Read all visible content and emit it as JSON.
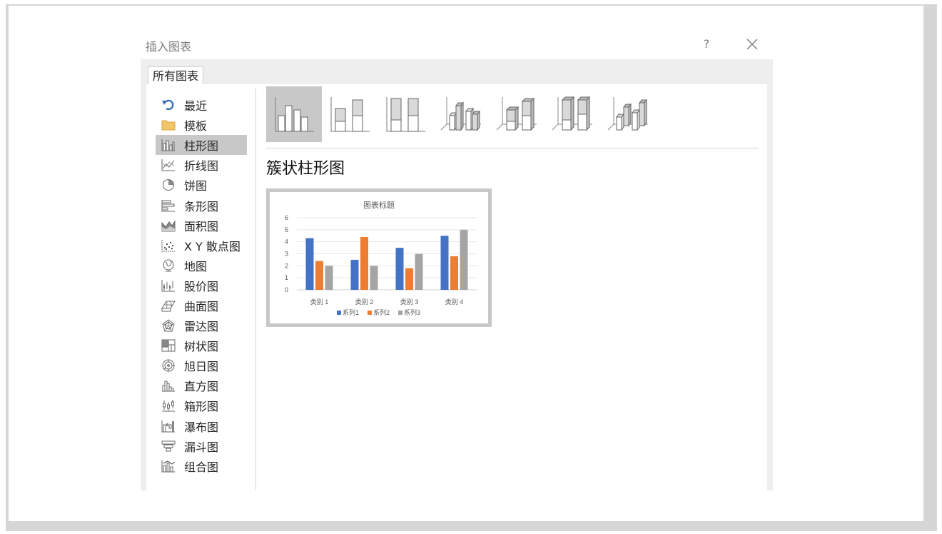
{
  "dialog": {
    "title": "插入图表",
    "help_label": "?",
    "close_icon": "close-icon"
  },
  "tabs": [
    {
      "label": "所有图表",
      "selected": true
    }
  ],
  "sidebar": {
    "items": [
      {
        "label": "最近",
        "icon": "recent-icon",
        "selected": false
      },
      {
        "label": "模板",
        "icon": "folder-icon",
        "selected": false
      },
      {
        "label": "柱形图",
        "icon": "column-chart-icon",
        "selected": true
      },
      {
        "label": "折线图",
        "icon": "line-chart-icon",
        "selected": false
      },
      {
        "label": "饼图",
        "icon": "pie-chart-icon",
        "selected": false
      },
      {
        "label": "条形图",
        "icon": "bar-chart-icon",
        "selected": false
      },
      {
        "label": "面积图",
        "icon": "area-chart-icon",
        "selected": false
      },
      {
        "label": "X Y 散点图",
        "icon": "scatter-chart-icon",
        "selected": false
      },
      {
        "label": "地图",
        "icon": "map-chart-icon",
        "selected": false
      },
      {
        "label": "股价图",
        "icon": "stock-chart-icon",
        "selected": false
      },
      {
        "label": "曲面图",
        "icon": "surface-chart-icon",
        "selected": false
      },
      {
        "label": "雷达图",
        "icon": "radar-chart-icon",
        "selected": false
      },
      {
        "label": "树状图",
        "icon": "treemap-chart-icon",
        "selected": false
      },
      {
        "label": "旭日图",
        "icon": "sunburst-chart-icon",
        "selected": false
      },
      {
        "label": "直方图",
        "icon": "histogram-chart-icon",
        "selected": false
      },
      {
        "label": "箱形图",
        "icon": "box-whisker-chart-icon",
        "selected": false
      },
      {
        "label": "瀑布图",
        "icon": "waterfall-chart-icon",
        "selected": false
      },
      {
        "label": "漏斗图",
        "icon": "funnel-chart-icon",
        "selected": false
      },
      {
        "label": "组合图",
        "icon": "combo-chart-icon",
        "selected": false
      }
    ]
  },
  "subtypes": [
    {
      "icon": "clustered-column-icon",
      "selected": true
    },
    {
      "icon": "stacked-column-icon",
      "selected": false
    },
    {
      "icon": "percent-stacked-column-icon",
      "selected": false
    },
    {
      "icon": "3d-clustered-column-icon",
      "selected": false
    },
    {
      "icon": "3d-stacked-column-icon",
      "selected": false
    },
    {
      "icon": "3d-percent-stacked-column-icon",
      "selected": false
    },
    {
      "icon": "3d-column-icon",
      "selected": false
    }
  ],
  "selected_chart_name": "簇状柱形图",
  "colors": {
    "series1": "#4472c4",
    "series2": "#ed7d31",
    "series3": "#a5a5a5",
    "selected_bg": "#c8c8c8"
  },
  "chart_data": {
    "type": "bar",
    "title": "图表标题",
    "categories": [
      "类别 1",
      "类别 2",
      "类别 3",
      "类别 4"
    ],
    "series": [
      {
        "name": "系列1",
        "values": [
          4.3,
          2.5,
          3.5,
          4.5
        ]
      },
      {
        "name": "系列2",
        "values": [
          2.4,
          4.4,
          1.8,
          2.8
        ]
      },
      {
        "name": "系列3",
        "values": [
          2,
          2,
          3,
          5
        ]
      }
    ],
    "ylim": [
      0,
      6
    ],
    "yticks": [
      "0",
      "1",
      "2",
      "3",
      "4",
      "5",
      "6"
    ],
    "grid": true,
    "legend": "bottom"
  }
}
